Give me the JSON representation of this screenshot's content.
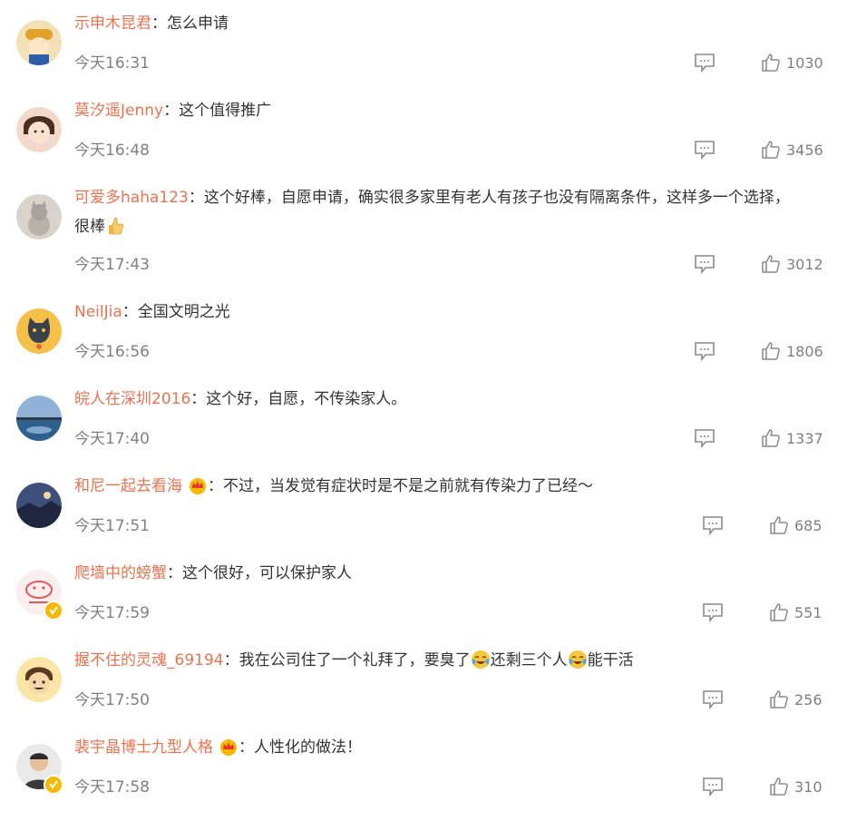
{
  "comments": [
    {
      "username": "示申木昆君",
      "text": "：怎么申请",
      "time": "今天16:31",
      "likes": "1030"
    },
    {
      "username": "莫汐遥Jenny",
      "text": "：这个值得推广",
      "time": "今天16:48",
      "likes": "3456"
    },
    {
      "username": "可爱多haha123",
      "text": "：这个好棒，自愿申请，确实很多家里有老人有孩子也没有隔离条件，这样多一个选择，",
      "text2": "很棒",
      "time": "今天17:43",
      "likes": "3012"
    },
    {
      "username": "NeilJia",
      "text": "：全国文明之光",
      "time": "今天16:56",
      "likes": "1806"
    },
    {
      "username": "皖人在深圳2016",
      "text": "：这个好，自愿，不传染家人。",
      "time": "今天17:40",
      "likes": "1337"
    },
    {
      "username": "和尼一起去看海",
      "text": "：不过，当发觉有症状时是不是之前就有传染力了已经～",
      "time": "今天17:51",
      "likes": "685"
    },
    {
      "username": "爬墙中的螃蟹",
      "text": "：这个很好，可以保护家人",
      "time": "今天17:59",
      "likes": "551"
    },
    {
      "username": "握不住的灵魂_69194",
      "text": "：我在公司住了一个礼拜了，要臭了",
      "text2": "还剩三个人",
      "text3": "能干活",
      "time": "今天17:50",
      "likes": "256"
    },
    {
      "username": "裴宇晶博士九型人格",
      "text": "：人性化的做法！",
      "time": "今天17:58",
      "likes": "310"
    }
  ],
  "colors": {
    "username": "#eb7350",
    "text": "#333333",
    "meta": "#808080",
    "vip": "#f6b800"
  },
  "icons": {
    "reply": "comment-bubble-icon",
    "like": "thumbs-up-icon",
    "vip": "crown-icon",
    "verified": "verified-v-icon"
  }
}
